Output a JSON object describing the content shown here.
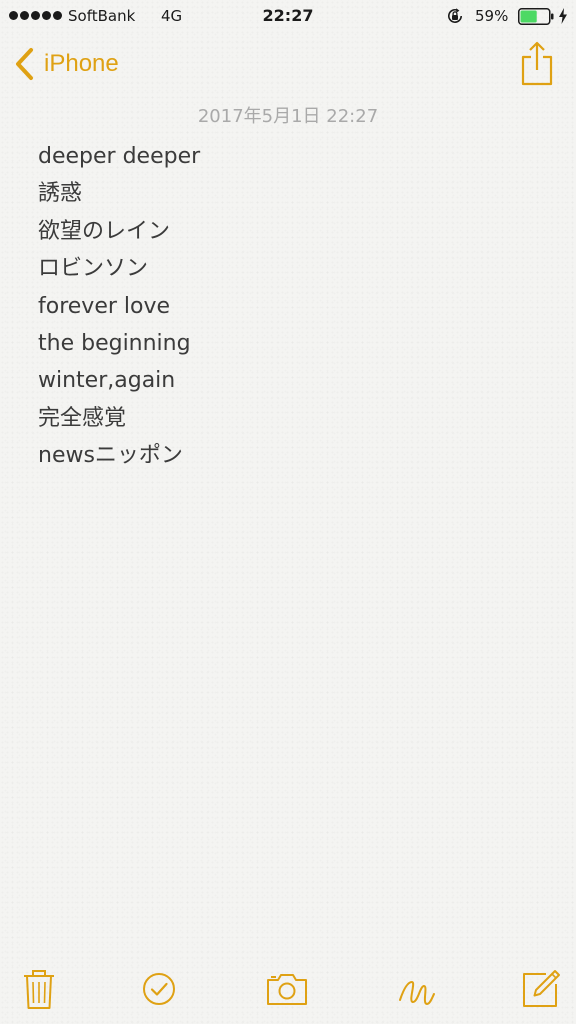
{
  "status_bar": {
    "carrier": "SoftBank",
    "network": "4G",
    "time": "22:27",
    "battery_percent": "59%",
    "battery_level": 0.59,
    "signal_bars": 5,
    "icons": [
      "orientation-lock-icon",
      "battery-icon",
      "charging-icon"
    ]
  },
  "nav": {
    "back_label": "iPhone",
    "back_icon": "chevron-left-icon",
    "share_icon": "share-icon"
  },
  "note": {
    "date": "2017年5月1日 22:27",
    "lines": [
      "deeper deeper",
      "誘惑",
      "欲望のレイン",
      "ロビンソン",
      "forever love",
      "the beginning",
      "winter,again",
      "完全感覚",
      "newsニッポン"
    ]
  },
  "toolbar": {
    "items": [
      "trash-icon",
      "checklist-icon",
      "camera-icon",
      "sketch-icon",
      "compose-icon"
    ]
  },
  "colors": {
    "accent": "#dfa113",
    "background": "#f4f4f2",
    "text": "#3b3b3b",
    "date_text": "#a9a9a9",
    "battery_fill": "#4cd964"
  }
}
